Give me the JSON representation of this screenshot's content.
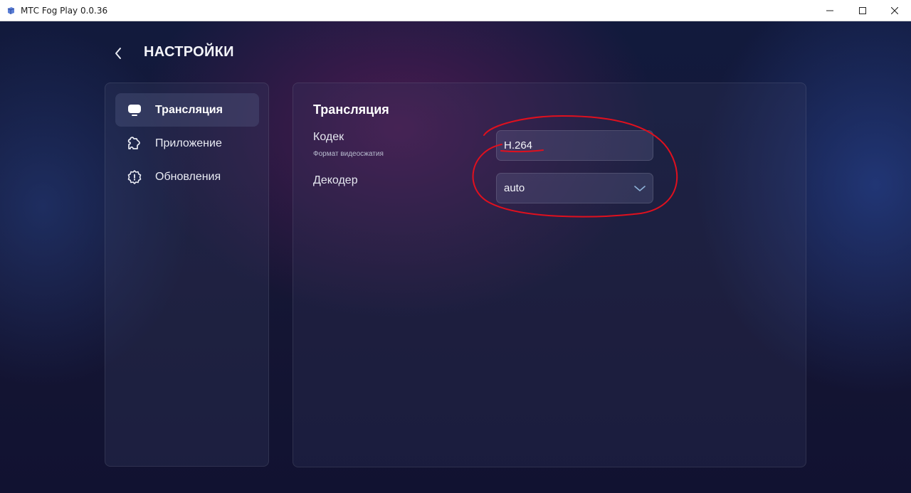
{
  "window": {
    "title": "МТС Fog Play 0.0.36"
  },
  "header": {
    "title": "НАСТРОЙКИ"
  },
  "sidebar": {
    "items": [
      {
        "label": "Трансляция",
        "icon": "monitor-icon",
        "active": true
      },
      {
        "label": "Приложение",
        "icon": "app-puzzle-icon",
        "active": false
      },
      {
        "label": "Обновления",
        "icon": "update-gear-icon",
        "active": false
      }
    ]
  },
  "panel": {
    "title": "Трансляция",
    "codec": {
      "label": "Кодек",
      "sublabel": "Формат видеосжатия",
      "value": "H.264"
    },
    "decoder": {
      "label": "Декодер",
      "value": "auto"
    }
  },
  "colors": {
    "annotation": "#e0101e",
    "background": "#121a3d",
    "accent_chevron": "#8fb3d9"
  }
}
